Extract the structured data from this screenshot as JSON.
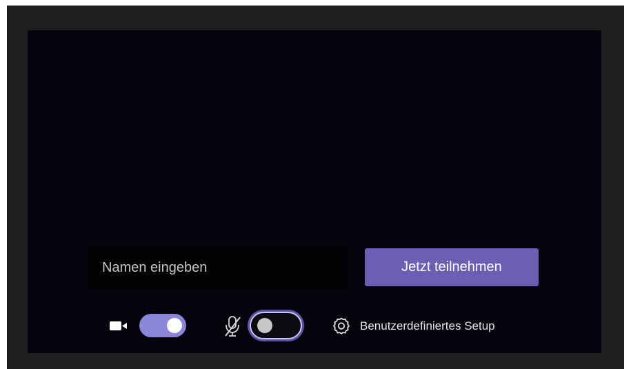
{
  "prejoin": {
    "name_input": {
      "placeholder": "Namen eingeben",
      "value": ""
    },
    "join_button_label": "Jetzt teilnehmen",
    "controls": {
      "camera": {
        "icon": "camera-icon",
        "enabled": true
      },
      "microphone": {
        "icon": "mic-off-icon",
        "enabled": false
      },
      "device_settings": {
        "icon": "gear-icon",
        "label": "Benutzerdefiniertes Setup"
      }
    }
  },
  "colors": {
    "accent": "#6b5fb3",
    "toggle_on": "#8b86d9",
    "panel_background": "#05040c",
    "frame_background": "#1e1e1e"
  }
}
